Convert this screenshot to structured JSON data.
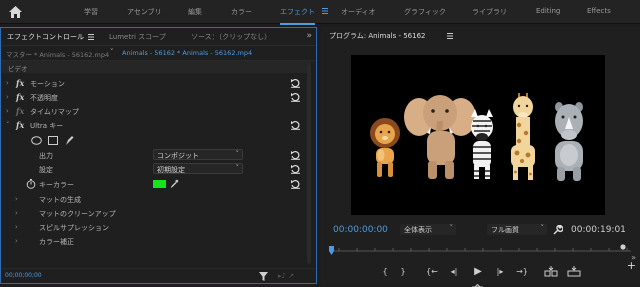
{
  "workspace": {
    "tabs": [
      "学習",
      "アセンブリ",
      "編集",
      "カラー",
      "エフェクト",
      "オーディオ",
      "グラフィック",
      "ライブラリ",
      "Editing",
      "Effects"
    ],
    "active": "エフェクト"
  },
  "left": {
    "tabs": [
      "エフェクトコントロール",
      "Lumetri スコープ",
      "ソース：（クリップなし）"
    ],
    "master_label": "マスター * Animals - 56162.mp4",
    "clip_label": "Animals - 56162 * Animals - 56162.mp4",
    "section_video": "ビデオ",
    "effects": [
      {
        "name": "モーション",
        "dim": false
      },
      {
        "name": "不透明度",
        "dim": false
      },
      {
        "name": "タイムリマップ",
        "dim": true
      },
      {
        "name": "Ultra キー",
        "dim": false
      }
    ],
    "props": {
      "output_label": "出力",
      "output_value": "コンポジット",
      "setting_label": "設定",
      "setting_value": "初期設定",
      "keycolor_label": "キーカラー",
      "keycolor_hex": "#16e51b"
    },
    "subgroups": [
      "マットの生成",
      "マットのクリーンアップ",
      "スピルサプレッション",
      "カラー補正"
    ],
    "timecode": "00;00;00;00"
  },
  "monitor": {
    "title": "プログラム: Animals - 56162",
    "current_tc": "00:00:00:00",
    "zoom": "全体表示",
    "quality": "フル画質",
    "duration": "00:00:19:01"
  },
  "colors": {
    "accent": "#4d9be0",
    "key_green": "#16e51b"
  }
}
